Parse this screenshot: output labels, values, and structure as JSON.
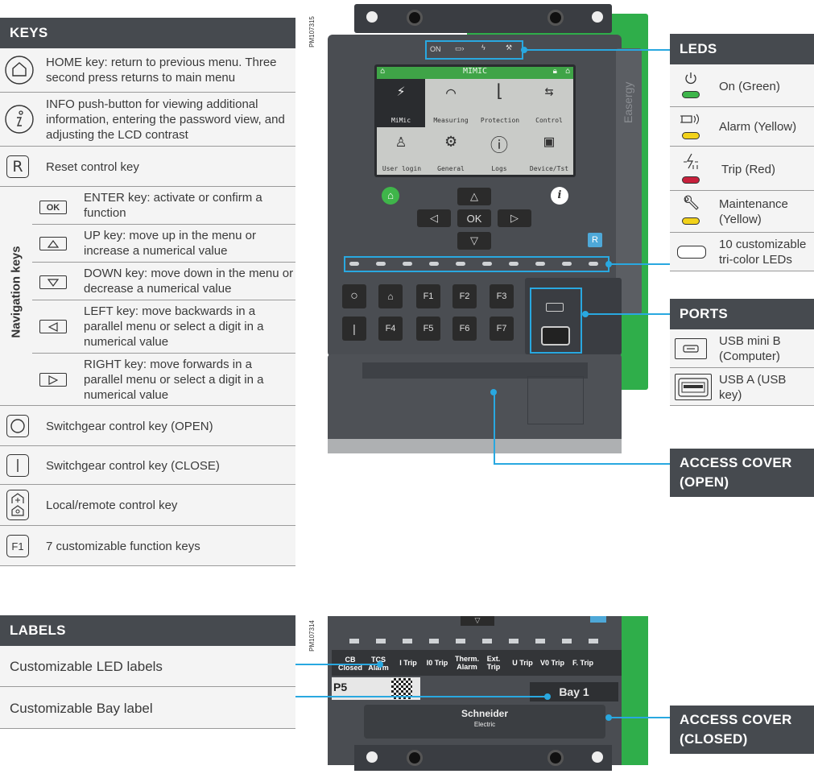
{
  "keys": {
    "header": "KEYS",
    "home": "HOME key:  return to previous menu. Three second press returns to main menu",
    "info": "INFO push-button for viewing additional information, entering the password view, and adjusting the LCD contrast",
    "reset_icon": "R",
    "reset": "Reset control key",
    "nav_label": "Navigation keys",
    "ok_icon": "OK",
    "enter": "ENTER key: activate or confirm a function",
    "up": "UP key: move up in the menu or increase a numerical value",
    "down": "DOWN key: move down in the menu or decrease a numerical value",
    "left": "LEFT key: move backwards in a parallel menu or select a digit in a numerical value",
    "right": "RIGHT key: move forwards in a parallel menu or select a digit in a numerical value",
    "open": "Switchgear control key (OPEN)",
    "close": "Switchgear control key (CLOSE)",
    "local_remote": "Local/remote control key",
    "f1_icon": "F1",
    "function": "7 customizable function keys"
  },
  "labels": {
    "header": "LABELS",
    "led_labels": "Customizable LED labels",
    "bay_label": "Customizable Bay label"
  },
  "leds": {
    "header": "LEDS",
    "on": "On (Green)",
    "alarm": "Alarm (Yellow)",
    "trip": "Trip (Red)",
    "maintenance": "Maintenance (Yellow)",
    "custom": "10  customizable tri-color LEDs",
    "colors": {
      "green": "#3db54a",
      "yellow": "#f2d21a",
      "red": "#c8203c"
    }
  },
  "ports": {
    "header": "PORTS",
    "usb_mini": "USB mini B (Computer)",
    "usb_a": "USB A (USB key)"
  },
  "access_open": "ACCESS COVER (OPEN)",
  "access_closed": "ACCESS COVER (CLOSED)",
  "device": {
    "code_top": "PM107315",
    "code_bottom": "PM107314",
    "brand_side": "Easergy",
    "led_on": "ON",
    "screen_title": "MIMIC",
    "menu": [
      "MiMic",
      "Measuring",
      "Protection",
      "Control",
      "User login",
      "General",
      "Logs",
      "Device/Tst"
    ],
    "ok": "OK",
    "fkeys": [
      "F1",
      "F2",
      "F3",
      "F4",
      "F5",
      "F6",
      "F7"
    ],
    "reset": "R",
    "led_labels": [
      "CB Closed",
      "TCS Alarm",
      "I Trip",
      "I0 Trip",
      "Therm. Alarm",
      "Ext. Trip",
      "U Trip",
      "V0 Trip",
      "F. Trip"
    ],
    "bay": "Bay 1",
    "p5": "P5",
    "brand": "Schneider",
    "brand_sub": "Electric",
    "accent_green": "#2fae4a"
  }
}
